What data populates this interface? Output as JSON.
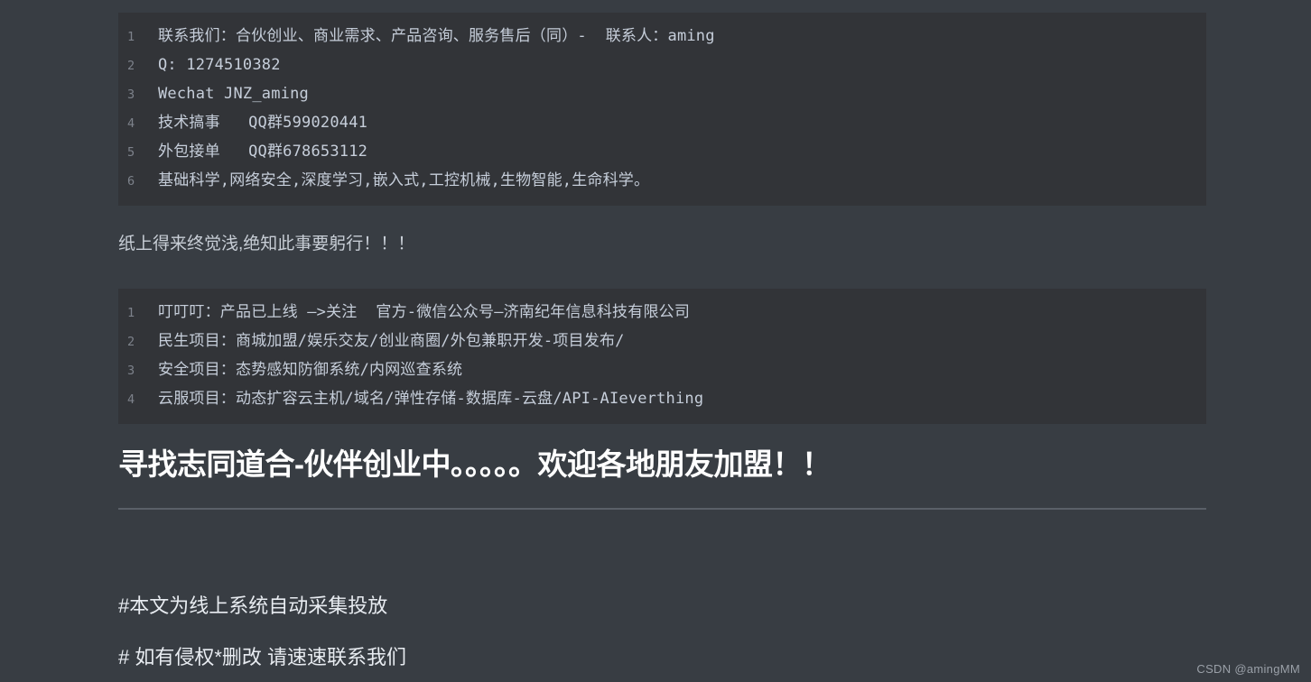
{
  "page": {
    "background_color": "#383d43",
    "code_background_color": "#323438",
    "code_text_color": "#c6ceda",
    "line_number_color": "#7d828b",
    "heading_color": "#ffffff",
    "divider_color": "#5a6068",
    "watermark_color": "#9aa0a8"
  },
  "code_block_1": {
    "lines": [
      {
        "number": "1",
        "text": "联系我们：合伙创业、商业需求、产品咨询、服务售后（同）-  联系人：aming"
      },
      {
        "number": "2",
        "text": "Q: 1274510382"
      },
      {
        "number": "3",
        "text": "Wechat JNZ_aming"
      },
      {
        "number": "4",
        "text": "技术搞事   QQ群599020441"
      },
      {
        "number": "5",
        "text": "外包接单   QQ群678653112"
      },
      {
        "number": "6",
        "text": "基础科学,网络安全,深度学习,嵌入式,工控机械,生物智能,生命科学。"
      }
    ]
  },
  "quote": {
    "text": "纸上得来终觉浅,绝知此事要躬行！！！"
  },
  "code_block_2": {
    "lines": [
      {
        "number": "1",
        "text": "叮叮叮：产品已上线 –>关注  官方-微信公众号—济南纪年信息科技有限公司"
      },
      {
        "number": "2",
        "text": "民生项目：商城加盟/娱乐交友/创业商圈/外包兼职开发-项目发布/"
      },
      {
        "number": "3",
        "text": "安全项目：态势感知防御系统/内网巡查系统"
      },
      {
        "number": "4",
        "text": "云服项目：动态扩容云主机/域名/弹性存储-数据库-云盘/API-AIeverthing"
      }
    ]
  },
  "heading": {
    "text": "寻找志同道合-伙伴创业中。。。。。欢迎各地朋友加盟！！"
  },
  "notes": {
    "line1": "#本文为线上系统自动采集投放",
    "line2": "# 如有侵权*删改 请速速联系我们"
  },
  "watermark": {
    "text": "CSDN @amingMM"
  }
}
